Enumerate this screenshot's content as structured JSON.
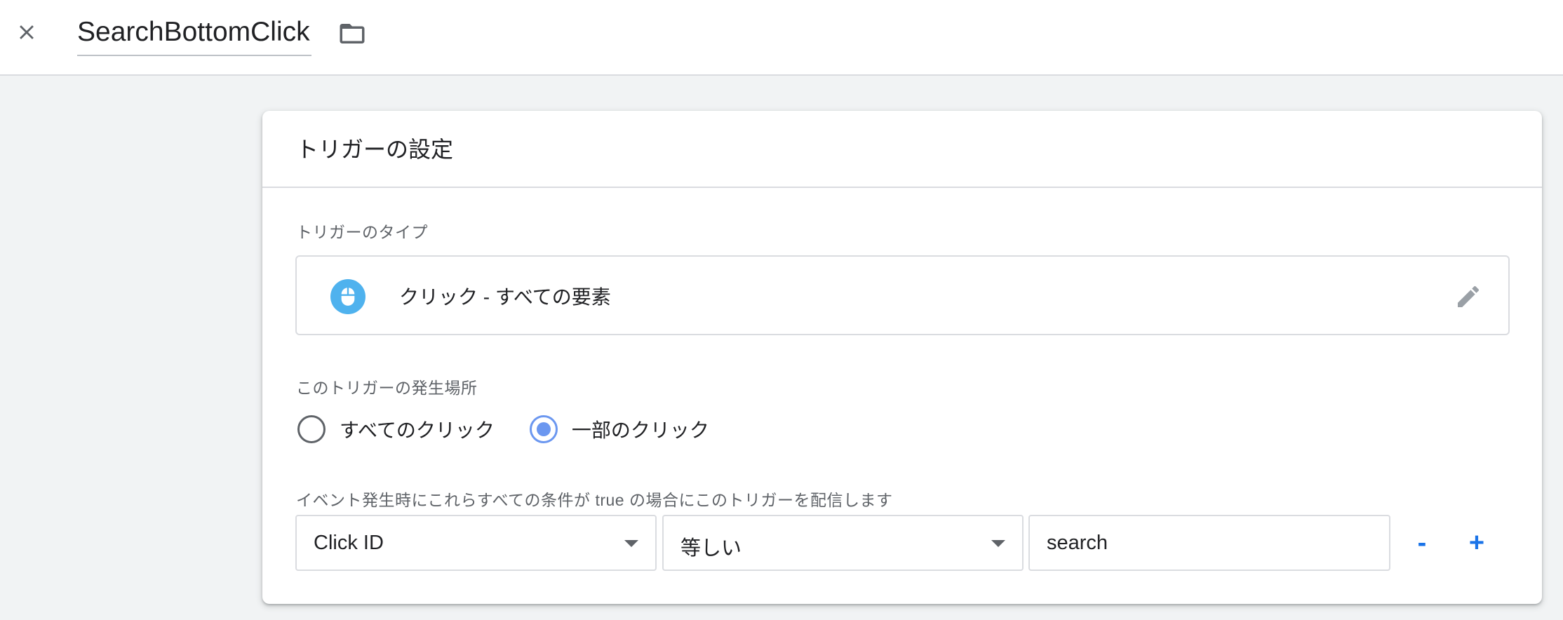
{
  "header": {
    "close_icon": "close-icon",
    "title": "SearchBottomClick",
    "folder_icon": "folder-icon"
  },
  "card": {
    "title": "トリガーの設定",
    "trigger_type": {
      "label": "トリガーのタイプ",
      "icon": "mouse-icon",
      "icon_color": "#4fb2ee",
      "name": "クリック - すべての要素",
      "edit_icon": "pencil-icon"
    },
    "firing": {
      "label": "このトリガーの発生場所",
      "options": [
        {
          "label": "すべてのクリック",
          "checked": false
        },
        {
          "label": "一部のクリック",
          "checked": true
        }
      ],
      "accent": "#6b97f0"
    },
    "conditions": {
      "label": "イベント発生時にこれらすべての条件が true の場合にこのトリガーを配信します",
      "variable": "Click ID",
      "operator": "等しい",
      "value": "search",
      "remove_label": "-",
      "add_label": "+",
      "accent": "#1a73e8"
    }
  }
}
